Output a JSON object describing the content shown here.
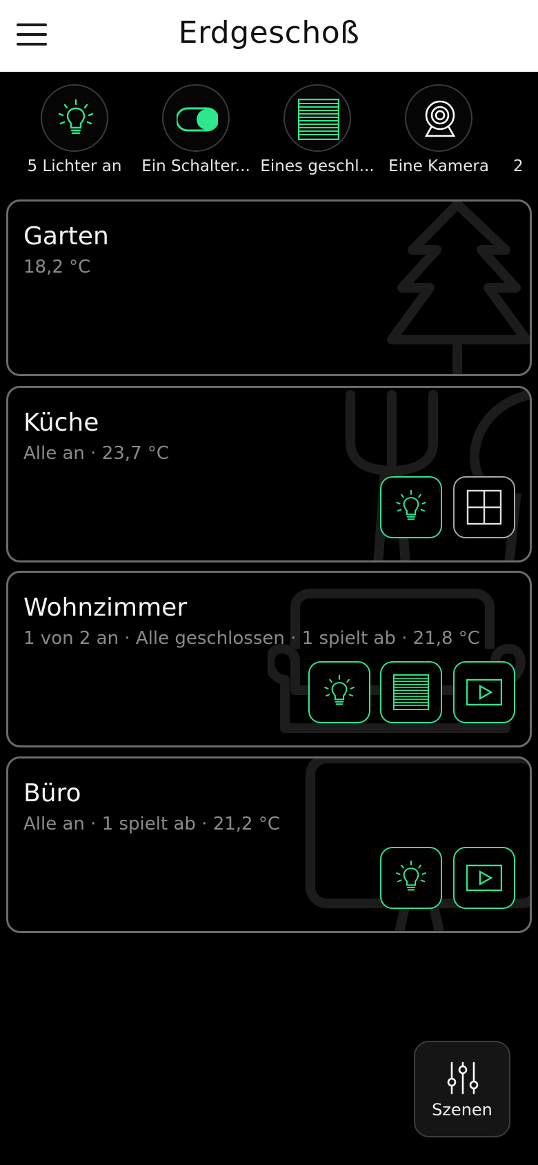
{
  "header": {
    "title": "Erdgeschoß",
    "menu_icon": "hamburger-menu-icon"
  },
  "summary_chips": [
    {
      "label": "5 Lichter an",
      "icon": "lightbulb-icon",
      "active": true
    },
    {
      "label": "Ein Schalter...",
      "icon": "toggle-switch-icon",
      "active": true
    },
    {
      "label": "Eines geschl...",
      "icon": "blinds-icon",
      "active": true
    },
    {
      "label": "Eine Kamera",
      "icon": "camera-icon",
      "active": false
    },
    {
      "label": "2",
      "icon": "",
      "active": false
    }
  ],
  "rooms": [
    {
      "name": "Garten",
      "status": "18,2 °C",
      "background_icon": "tree-icon",
      "devices": []
    },
    {
      "name": "Küche",
      "status": "Alle an · 23,7 °C",
      "background_icon": "cutlery-icon",
      "devices": [
        {
          "icon": "lightbulb-icon",
          "active": true
        },
        {
          "icon": "window-icon",
          "active": false
        }
      ]
    },
    {
      "name": "Wohnzimmer",
      "status": "1 von 2 an · Alle geschlossen · 1 spielt ab · 21,8 °C",
      "background_icon": "sofa-icon",
      "devices": [
        {
          "icon": "lightbulb-icon",
          "active": true
        },
        {
          "icon": "blinds-icon",
          "active": true
        },
        {
          "icon": "media-player-icon",
          "active": true
        }
      ]
    },
    {
      "name": "Büro",
      "status": "Alle an · 1 spielt ab · 21,2 °C",
      "background_icon": "desk-icon",
      "devices": [
        {
          "icon": "lightbulb-icon",
          "active": true
        },
        {
          "icon": "media-player-icon",
          "active": true
        }
      ]
    }
  ],
  "scenes_button": {
    "label": "Szenen",
    "icon": "sliders-icon"
  },
  "colors": {
    "accent": "#2ee68c",
    "card_border": "#6b6b6b",
    "muted_text": "#8a8a8a",
    "background": "#000000"
  }
}
